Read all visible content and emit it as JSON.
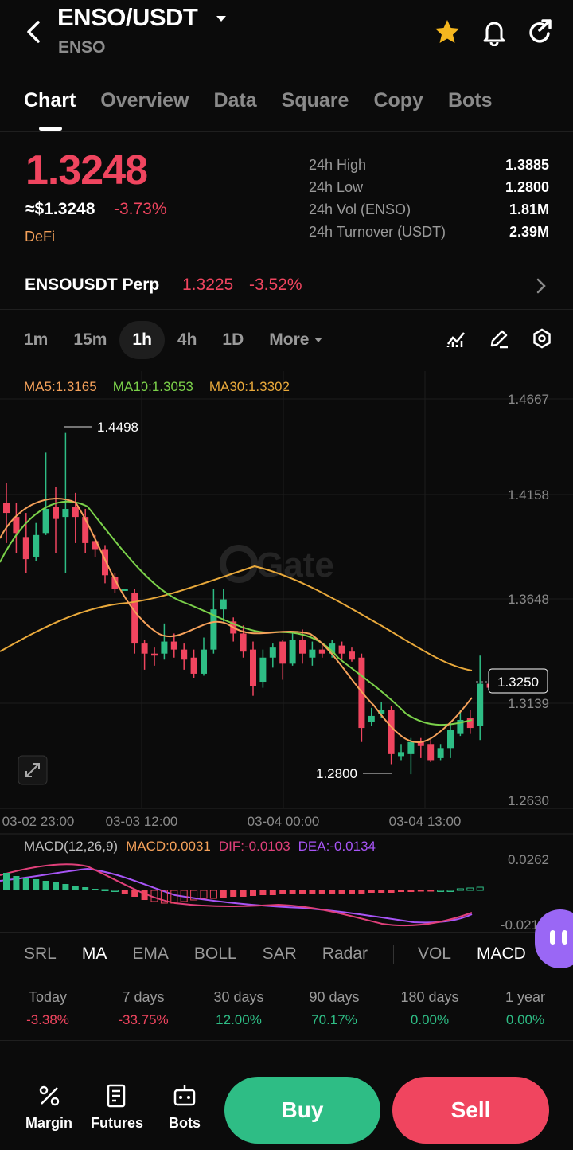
{
  "header": {
    "pair": "ENSO/USDT",
    "sub": "ENSO"
  },
  "tabs": [
    "Chart",
    "Overview",
    "Data",
    "Square",
    "Copy",
    "Bots"
  ],
  "ticker": {
    "price": "1.3248",
    "usd": "≈$1.3248",
    "change": "-3.73%",
    "tag": "DeFi",
    "stats": [
      {
        "label": "24h  High",
        "value": "1.3885"
      },
      {
        "label": "24h  Low",
        "value": "1.2800"
      },
      {
        "label": "24h  Vol (ENSO)",
        "value": "1.81M"
      },
      {
        "label": "24h  Turnover (USDT)",
        "value": "2.39M"
      }
    ]
  },
  "perp": {
    "name": "ENSOUSDT Perp",
    "price": "1.3225",
    "change": "-3.52%"
  },
  "intervals": [
    "1m",
    "15m",
    "1h",
    "4h",
    "1D",
    "More"
  ],
  "ma_legend": {
    "ma5": "MA5:1.3165",
    "ma10": "MA10:1.3053",
    "ma30": "MA30:1.3302"
  },
  "chart_data": {
    "type": "candlestick",
    "watermark": "Gate",
    "y_ticks": [
      "1.4667",
      "1.4158",
      "1.3648",
      "1.3139",
      "1.2630"
    ],
    "ylim": [
      1.263,
      1.4667
    ],
    "x_ticks": [
      "03-02 23:00",
      "03-03 12:00",
      "03-04 00:00",
      "03-04 13:00"
    ],
    "high_label": "1.4498",
    "low_label": "1.2800",
    "last_price_label": "1.3250",
    "colors": {
      "up": "#2ebd85",
      "down": "#f0455f",
      "ma5": "#f5a15a",
      "ma10": "#7bd14a",
      "ma30": "#e9a93b"
    }
  },
  "macd": {
    "label": "MACD(12,26,9)",
    "macd": "MACD:0.0031",
    "dif": "DIF:-0.0103",
    "dea": "DEA:-0.0134",
    "y_top": "0.0262",
    "y_bottom": "-0.021"
  },
  "indicators": [
    "SRL",
    "MA",
    "EMA",
    "BOLL",
    "SAR",
    "Radar",
    "VOL",
    "MACD"
  ],
  "performance": [
    {
      "label": "Today",
      "value": "-3.38%"
    },
    {
      "label": "7 days",
      "value": "-33.75%"
    },
    {
      "label": "30 days",
      "value": "12.00%"
    },
    {
      "label": "90 days",
      "value": "70.17%"
    },
    {
      "label": "180 days",
      "value": "0.00%"
    },
    {
      "label": "1 year",
      "value": "0.00%"
    }
  ],
  "bottom_nav": {
    "margin": "Margin",
    "futures": "Futures",
    "bots": "Bots",
    "buy": "Buy",
    "sell": "Sell"
  }
}
